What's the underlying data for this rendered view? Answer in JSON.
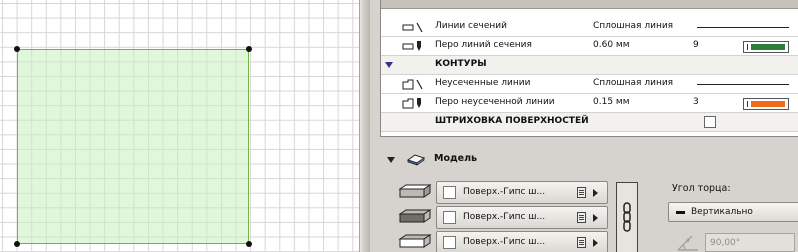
{
  "sections": {
    "rows": [
      {
        "label": "Линии сечений",
        "value": "Сплошная линия"
      },
      {
        "label": "Перо линий сечения",
        "value": "0.60 мм",
        "pen": "9",
        "pen_color": "#2e7d3a"
      }
    ]
  },
  "contours": {
    "title": "КОНТУРЫ",
    "rows": [
      {
        "label": "Неусеченные линии",
        "value": "Сплошная линия"
      },
      {
        "label": "Перо неусеченной линии",
        "value": "0.15 мм",
        "pen": "3",
        "pen_color": "#f26a1b"
      }
    ]
  },
  "hatching": {
    "title": "ШТРИХОВКА ПОВЕРХНОСТЕЙ"
  },
  "model": {
    "title": "Модель",
    "surfaces": [
      {
        "label": "Поверх.-Гипс ш...",
        "icon": "top-surface-icon"
      },
      {
        "label": "Поверх.-Гипс ш...",
        "icon": "side-surface-icon"
      },
      {
        "label": "Поверх.-Гипс ш...",
        "icon": "bottom-surface-icon"
      }
    ],
    "edge_angle": {
      "label": "Угол торца:",
      "value": "Вертикально",
      "degrees": "90,00°"
    }
  },
  "colors": {
    "slab_fill": "#c6f0be",
    "slab_stroke": "#6cb743",
    "pen_9": "#2e7d3a",
    "pen_3": "#f26a1b"
  }
}
